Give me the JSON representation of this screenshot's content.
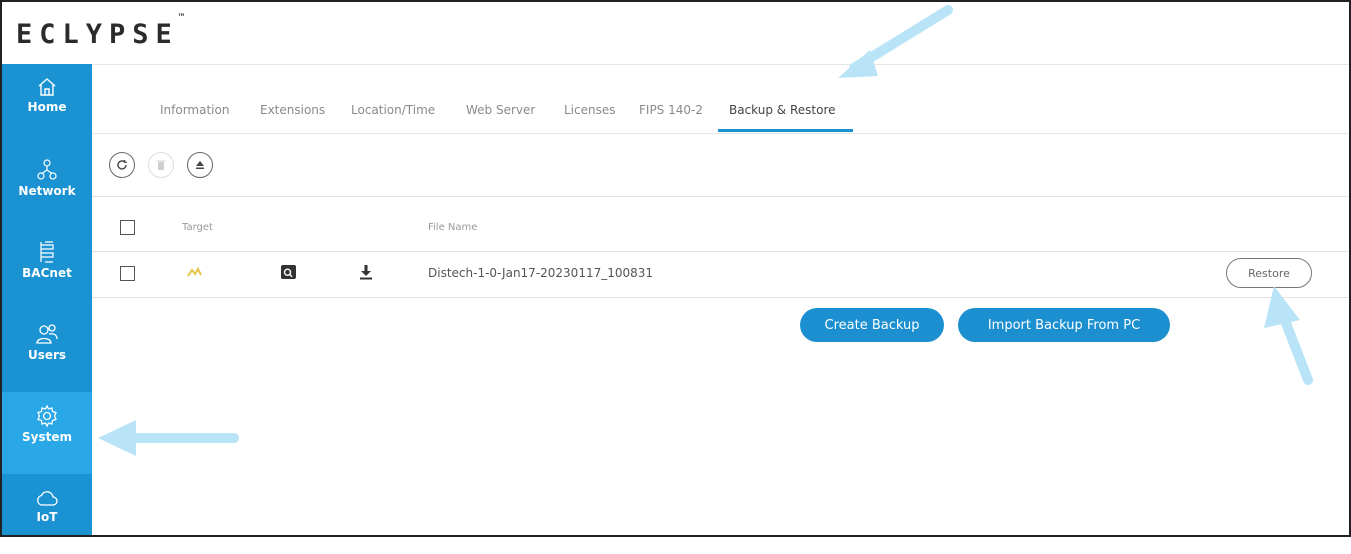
{
  "app": {
    "logo_text": "ECLYPSE",
    "logo_mark": "™"
  },
  "sidebar": {
    "items": [
      {
        "label": "Home",
        "icon": "home-icon"
      },
      {
        "label": "Network",
        "icon": "network-icon"
      },
      {
        "label": "BACnet",
        "icon": "bacnet-icon"
      },
      {
        "label": "Users",
        "icon": "users-icon"
      },
      {
        "label": "System",
        "icon": "gear-icon",
        "active": true
      },
      {
        "label": "IoT",
        "icon": "cloud-icon"
      }
    ]
  },
  "tabs": [
    {
      "label": "Information"
    },
    {
      "label": "Extensions"
    },
    {
      "label": "Location/Time"
    },
    {
      "label": "Web Server"
    },
    {
      "label": "Licenses"
    },
    {
      "label": "FIPS 140-2"
    },
    {
      "label": "Backup & Restore",
      "active": true
    }
  ],
  "toolbar": {
    "buttons": [
      {
        "icon": "refresh-icon"
      },
      {
        "icon": "trash-icon",
        "disabled": true
      },
      {
        "icon": "eject-icon"
      }
    ]
  },
  "table": {
    "headers": {
      "target": "Target",
      "file_name": "File Name"
    },
    "rows": [
      {
        "file_name": "Distech-1-0-Jan17-20230117_100831",
        "restore_label": "Restore"
      }
    ]
  },
  "actions": {
    "create_backup": "Create Backup",
    "import_backup": "Import Backup From PC"
  },
  "colors": {
    "sidebar": "#1b93d2",
    "sidebar_active": "#2aa7e6",
    "primary": "#1b8fcf",
    "annotation_arrow": "#b9e4f7"
  }
}
